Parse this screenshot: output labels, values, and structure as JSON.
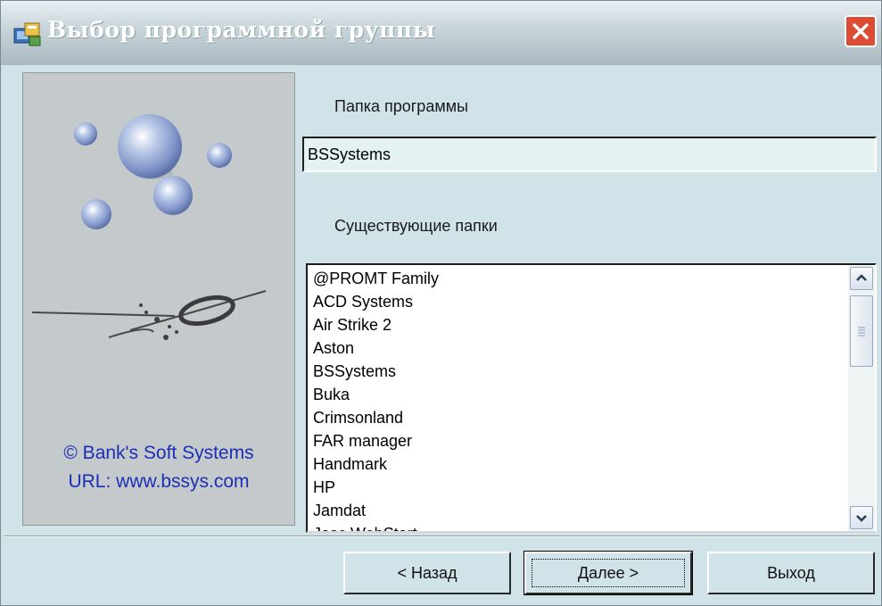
{
  "window": {
    "title": "Выбор программной группы"
  },
  "side_panel": {
    "copyright_line1": "© Bank's Soft Systems",
    "copyright_line2": "URL: www.bssys.com"
  },
  "program_folder": {
    "label": "Папка программы",
    "value": "BSSystems"
  },
  "existing_folders": {
    "label": "Существующие папки",
    "items": [
      "@PROMT Family",
      "ACD Systems",
      "Air Strike 2",
      "Aston",
      "BSSystems",
      "Buka",
      "Crimsonland",
      "FAR manager",
      "Handmark",
      "HP",
      "Jamdat",
      "Jasc WebStart"
    ]
  },
  "buttons": {
    "back": "< Назад",
    "next": "Далее >",
    "exit": "Выход"
  },
  "colors": {
    "background": "#cfe3e8",
    "copyright_text": "#1c2eb5",
    "close_button": "#dc4b34"
  }
}
